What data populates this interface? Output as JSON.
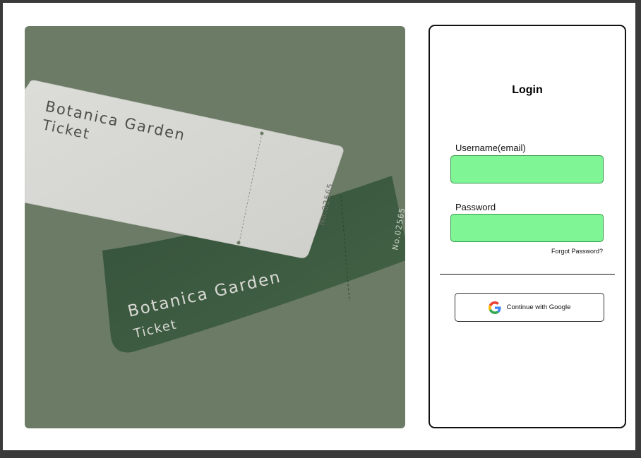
{
  "hero": {
    "ticket_front_line1": "Botanica Garden",
    "ticket_front_line2": "Ticket",
    "ticket_front_number": "No.02565",
    "ticket_back_line1": "Botanica Garden",
    "ticket_back_line2": "Ticket",
    "ticket_back_number": "No.02565"
  },
  "login": {
    "title": "Login",
    "username_label": "Username(email)",
    "username_value": "",
    "password_label": "Password",
    "password_value": "",
    "forgot_password": "Forgot Password?",
    "google_button": "Continue with Google"
  },
  "colors": {
    "hero_background": "#6b7b65",
    "input_fill": "#80f596",
    "front_ticket": "#d8d8d4",
    "back_ticket": "#3c5a3e"
  },
  "icons": {
    "google": "google-icon"
  }
}
